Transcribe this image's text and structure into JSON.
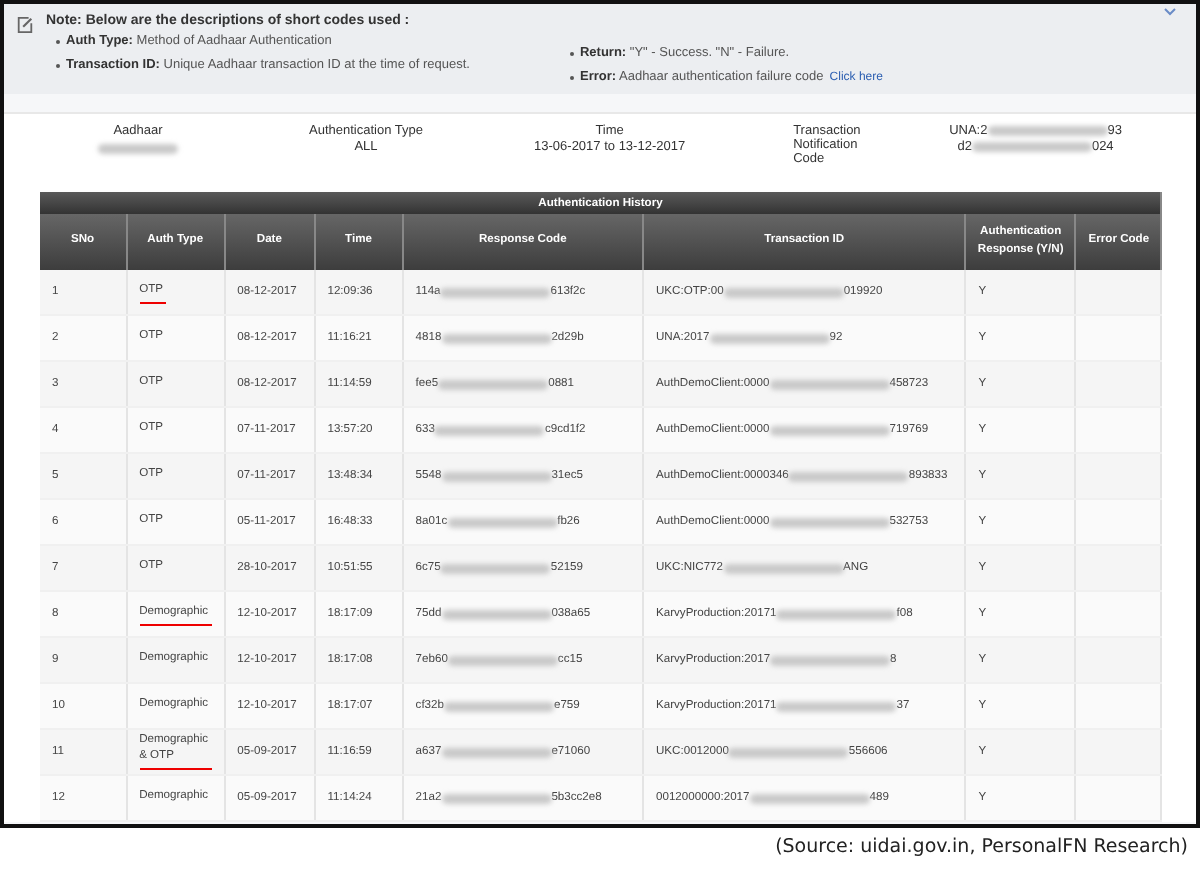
{
  "note": {
    "title": "Note: Below are the descriptions of short codes used :",
    "left": [
      {
        "term": "Auth Type:",
        "desc": "Method of Aadhaar Authentication"
      },
      {
        "term": "Transaction ID:",
        "desc": "Unique Aadhaar transaction ID at the time of request."
      }
    ],
    "right": [
      {
        "term": "Return:",
        "desc": "\"Y\" - Success. \"N\" - Failure."
      },
      {
        "term": "Error:",
        "desc": "Aadhaar authentication failure code",
        "link": "Click here"
      }
    ]
  },
  "summary": [
    {
      "label": "Aadhaar"
    },
    {
      "label": "Authentication Type",
      "values": [
        {
          "start": "ALL"
        }
      ]
    },
    {
      "label": "Time",
      "values": [
        {
          "start": "13-06-2017 to 13-12-2017"
        }
      ]
    },
    {
      "label": "Transaction Notification Code",
      "values": [
        {
          "start": "UNA:2",
          "end": "93"
        },
        {
          "start": "d2",
          "end": "024"
        }
      ]
    }
  ],
  "table": {
    "title": "Authentication History",
    "columns": [
      "SNo",
      "Auth Type",
      "Date",
      "Time",
      "Response Code",
      "Transaction ID",
      "Authentication Response (Y/N)",
      "Error Code"
    ],
    "rows": [
      {
        "sno": "1",
        "auth_type": "OTP",
        "underlined": true,
        "date": "08-12-2017",
        "time": "12:09:36",
        "response_code": {
          "start": "114a",
          "end": "613f2c"
        },
        "transaction_id": {
          "start": "UKC:OTP:00",
          "end": "019920"
        },
        "response": "Y"
      },
      {
        "sno": "2",
        "auth_type": "OTP",
        "underlined": false,
        "date": "08-12-2017",
        "time": "11:16:21",
        "response_code": {
          "start": "4818",
          "end": "2d29b"
        },
        "transaction_id": {
          "start": "UNA:2017",
          "end": "92"
        },
        "response": "Y"
      },
      {
        "sno": "3",
        "auth_type": "OTP",
        "underlined": false,
        "date": "08-12-2017",
        "time": "11:14:59",
        "response_code": {
          "start": "fee5",
          "end": "0881"
        },
        "transaction_id": {
          "start": "AuthDemoClient:0000",
          "end": "458723"
        },
        "response": "Y"
      },
      {
        "sno": "4",
        "auth_type": "OTP",
        "underlined": false,
        "date": "07-11-2017",
        "time": "13:57:20",
        "response_code": {
          "start": "633",
          "end": "c9cd1f2"
        },
        "transaction_id": {
          "start": "AuthDemoClient:0000",
          "end": "719769"
        },
        "response": "Y"
      },
      {
        "sno": "5",
        "auth_type": "OTP",
        "underlined": false,
        "date": "07-11-2017",
        "time": "13:48:34",
        "response_code": {
          "start": "5548",
          "end": "31ec5"
        },
        "transaction_id": {
          "start": "AuthDemoClient:0000346",
          "end": "893833"
        },
        "response": "Y"
      },
      {
        "sno": "6",
        "auth_type": "OTP",
        "underlined": false,
        "date": "05-11-2017",
        "time": "16:48:33",
        "response_code": {
          "start": "8a01c",
          "end": "fb26"
        },
        "transaction_id": {
          "start": "AuthDemoClient:0000",
          "end": "532753"
        },
        "response": "Y"
      },
      {
        "sno": "7",
        "auth_type": "OTP",
        "underlined": false,
        "date": "28-10-2017",
        "time": "10:51:55",
        "response_code": {
          "start": "6c75",
          "end": "52159"
        },
        "transaction_id": {
          "start": "UKC:NIC772",
          "end": "ANG"
        },
        "response": "Y"
      },
      {
        "sno": "8",
        "auth_type": "Demographic",
        "underlined": true,
        "date": "12-10-2017",
        "time": "18:17:09",
        "response_code": {
          "start": "75dd",
          "end": "038a65"
        },
        "transaction_id": {
          "start": "KarvyProduction:20171",
          "end": "f08"
        },
        "response": "Y"
      },
      {
        "sno": "9",
        "auth_type": "Demographic",
        "underlined": false,
        "date": "12-10-2017",
        "time": "18:17:08",
        "response_code": {
          "start": "7eb60",
          "end": "cc15"
        },
        "transaction_id": {
          "start": "KarvyProduction:2017",
          "end": "8"
        },
        "response": "Y"
      },
      {
        "sno": "10",
        "auth_type": "Demographic",
        "underlined": false,
        "date": "12-10-2017",
        "time": "18:17:07",
        "response_code": {
          "start": "cf32b",
          "end": "e759"
        },
        "transaction_id": {
          "start": "KarvyProduction:20171",
          "end": "37"
        },
        "response": "Y"
      },
      {
        "sno": "11",
        "auth_type": "Demographic & OTP",
        "underlined": true,
        "date": "05-09-2017",
        "time": "11:16:59",
        "response_code": {
          "start": "a637",
          "end": "e71060"
        },
        "transaction_id": {
          "start": "UKC:0012000",
          "end": "556606"
        },
        "response": "Y"
      },
      {
        "sno": "12",
        "auth_type": "Demographic",
        "underlined": false,
        "date": "05-09-2017",
        "time": "11:14:24",
        "response_code": {
          "start": "21a2",
          "end": "5b3cc2e8"
        },
        "transaction_id": {
          "start": "0012000000:2017",
          "end": "489"
        },
        "response": "Y"
      }
    ]
  },
  "caption": "(Source: uidai.gov.in, PersonalFN Research)"
}
